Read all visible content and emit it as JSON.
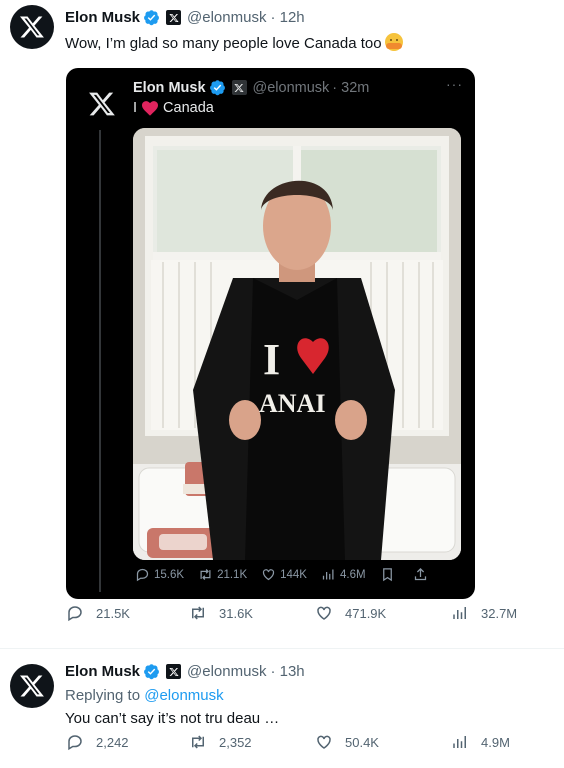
{
  "tweet1": {
    "name": "Elon Musk",
    "handle": "@elonmusk",
    "time": "· 12h",
    "text": "Wow, I’m glad so many people love Canada too",
    "quote": {
      "name": "Elon Musk",
      "handle": "@elonmusk",
      "time": "· 32m",
      "more": "···",
      "text_before": "I",
      "text_after": "Canada",
      "shirt_text_top": "I",
      "shirt_text_bottom": "ANAI",
      "actions": {
        "replies": "15.6K",
        "retweets": "21.1K",
        "likes": "144K",
        "views": "4.6M"
      }
    },
    "actions": {
      "replies": "21.5K",
      "retweets": "31.6K",
      "likes": "471.9K",
      "views": "32.7M"
    }
  },
  "tweet2": {
    "name": "Elon Musk",
    "handle": "@elonmusk",
    "time": "· 13h",
    "replying_label": "Replying to",
    "replying_mention": "@elonmusk",
    "text": "You can’t say it’s not tru deau …",
    "actions": {
      "replies": "2,242",
      "retweets": "2,352",
      "likes": "50.4K",
      "views": "4.9M"
    }
  },
  "colors": {
    "accent": "#1d9bf0",
    "heart": "#e0245e",
    "muted": "#536471"
  }
}
